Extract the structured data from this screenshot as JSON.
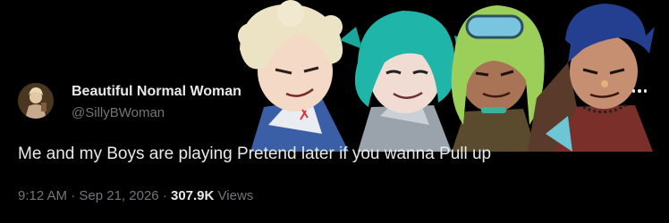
{
  "author": {
    "display_name": "Beautiful Normal Woman",
    "handle": "@SillyBWoman",
    "avatar_icon": "avatar-photo"
  },
  "more_menu": {
    "icon": "more-horizontal-icon"
  },
  "tweet": {
    "text": "Me and my Boys are playing Pretend later if you wanna Pull up"
  },
  "meta": {
    "time": "9:12 AM",
    "separator": "·",
    "date": "Sep 21, 2026",
    "views_count": "307.9K",
    "views_label": "Views"
  },
  "media": {
    "image_icon": "illustration-four-characters"
  },
  "colors": {
    "background": "#000000",
    "primary_text": "#e7e9ea",
    "secondary_text": "#71767b"
  }
}
